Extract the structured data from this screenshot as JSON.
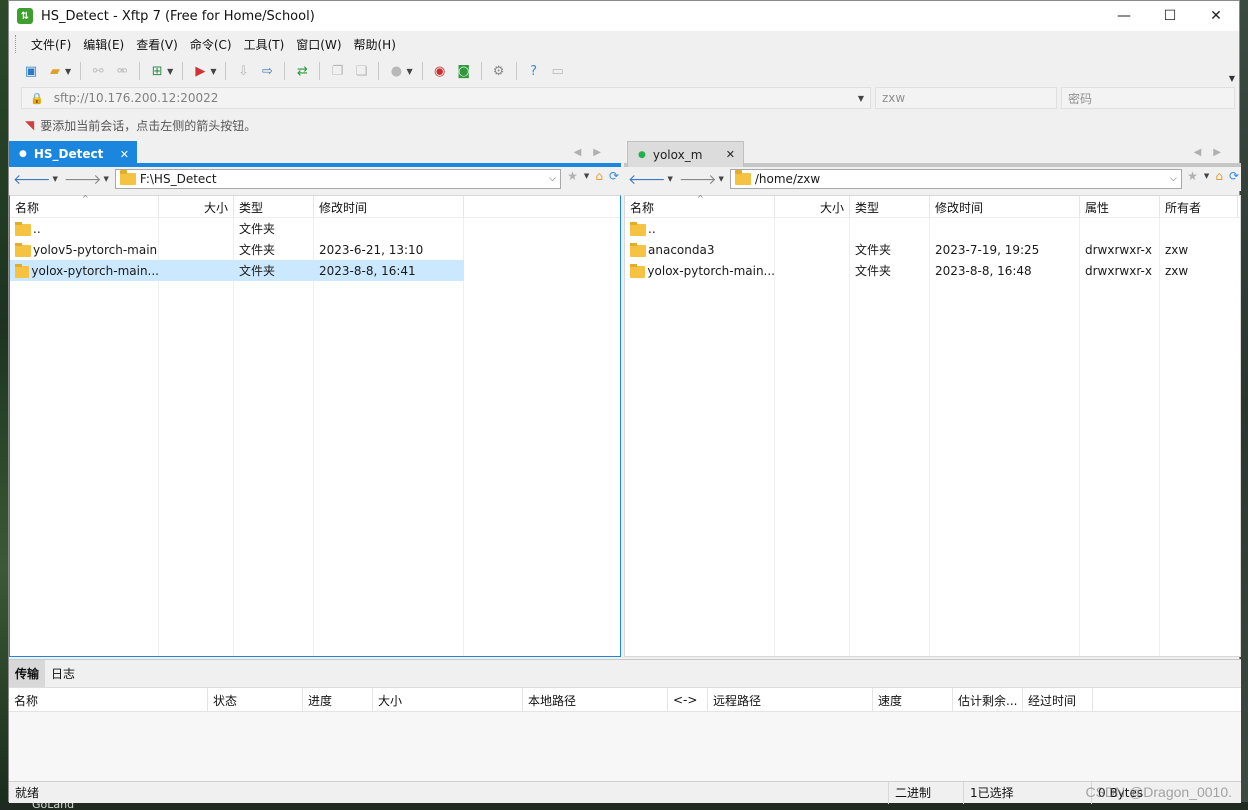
{
  "window": {
    "title": "HS_Detect - Xftp 7 (Free for Home/School)",
    "minimize_icon": "minimize-icon",
    "maximize_icon": "maximize-icon",
    "close_icon": "close-icon"
  },
  "menu": [
    "文件(F)",
    "编辑(E)",
    "查看(V)",
    "命令(C)",
    "工具(T)",
    "窗口(W)",
    "帮助(H)"
  ],
  "address": {
    "url_placeholder": "sftp://10.176.200.12:20022",
    "user_placeholder": "zxw",
    "password_placeholder": "密码"
  },
  "hint": "要添加当前会话，点击左侧的箭头按钮。",
  "left_pane": {
    "tab": "HS_Detect",
    "path": "F:\\HS_Detect",
    "columns": [
      "名称",
      "大小",
      "类型",
      "修改时间"
    ],
    "rows": [
      {
        "name": "..",
        "size": "",
        "type": "文件夹",
        "modified": ""
      },
      {
        "name": "yolov5-pytorch-main",
        "size": "",
        "type": "文件夹",
        "modified": "2023-6-21, 13:10"
      },
      {
        "name": "yolox-pytorch-main...",
        "size": "",
        "type": "文件夹",
        "modified": "2023-8-8, 16:41"
      }
    ]
  },
  "right_pane": {
    "tab": "yolox_m",
    "path": "/home/zxw",
    "columns": [
      "名称",
      "大小",
      "类型",
      "修改时间",
      "属性",
      "所有者"
    ],
    "rows": [
      {
        "name": "..",
        "size": "",
        "type": "",
        "modified": "",
        "perm": "",
        "owner": ""
      },
      {
        "name": "anaconda3",
        "size": "",
        "type": "文件夹",
        "modified": "2023-7-19, 19:25",
        "perm": "drwxrwxr-x",
        "owner": "zxw"
      },
      {
        "name": "yolox-pytorch-main...",
        "size": "",
        "type": "文件夹",
        "modified": "2023-8-8, 16:48",
        "perm": "drwxrwxr-x",
        "owner": "zxw"
      }
    ]
  },
  "bottom_tabs": [
    "传输",
    "日志"
  ],
  "transfer_columns": [
    "名称",
    "状态",
    "进度",
    "大小",
    "本地路径",
    "<->",
    "远程路径",
    "速度",
    "估计剩余...",
    "经过时间"
  ],
  "status": {
    "left": "就绪",
    "mode": "二进制",
    "selection": "1已选择",
    "bytes": "0 Bytes"
  },
  "watermark": "CSDN @Dragon_0010.",
  "desktop_label": "GoLand",
  "colors": {
    "accent": "#1a86dd",
    "selected_row": "#cce8ff",
    "folder": "#f5c242",
    "connected_dot": "#22b14c"
  }
}
